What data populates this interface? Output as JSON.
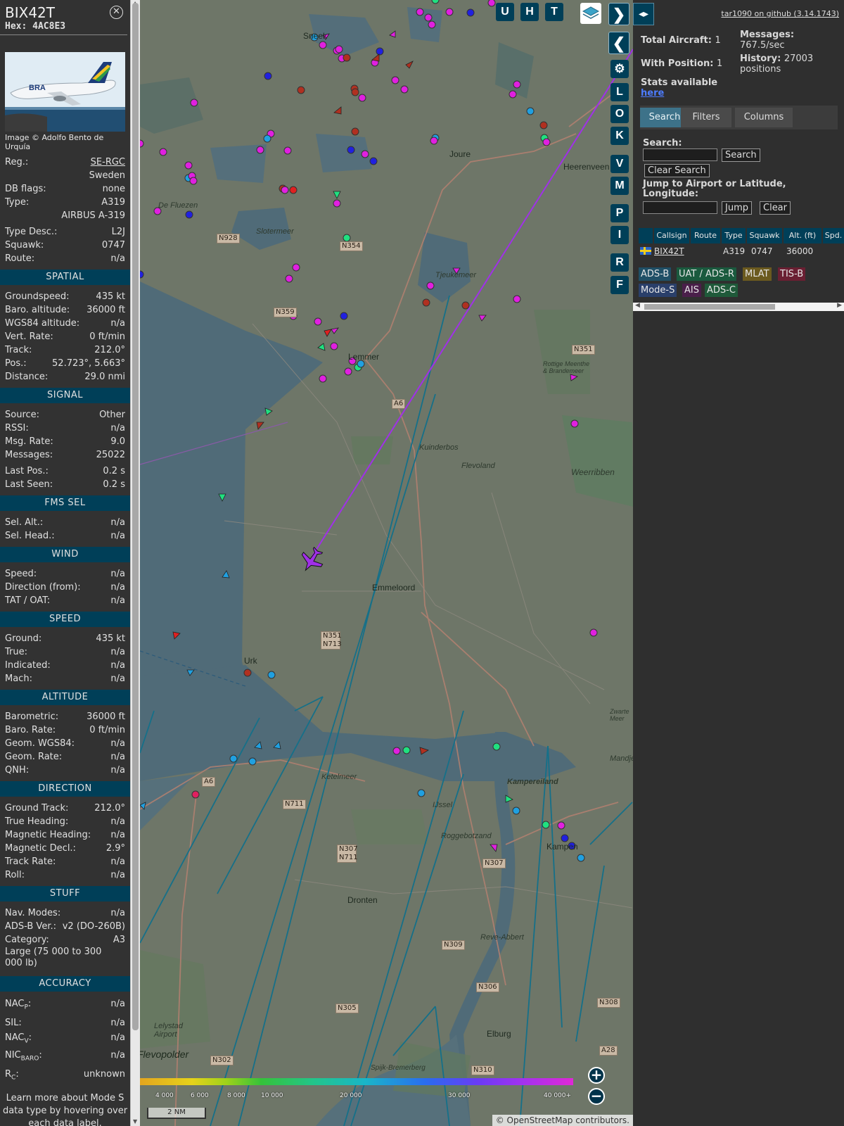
{
  "aircraft": {
    "callsign": "BIX42T",
    "hex_label": "Hex:",
    "hex": "4AC8E3",
    "image_credit": "Image © Adolfo Bento de Urquía",
    "reg_label": "Reg.:",
    "reg": "SE-RGC",
    "country": "Sweden",
    "dbflags_label": "DB flags:",
    "dbflags": "none",
    "type_label": "Type:",
    "type": "A319",
    "type_name": "AIRBUS A-319",
    "typedesc_label": "Type Desc.:",
    "typedesc": "L2J",
    "squawk_label": "Squawk:",
    "squawk": "0747",
    "route_label": "Route:",
    "route": "n/a"
  },
  "sections": {
    "spatial": "SPATIAL",
    "signal": "SIGNAL",
    "fms": "FMS SEL",
    "wind": "WIND",
    "speed": "SPEED",
    "altitude": "ALTITUDE",
    "direction": "DIRECTION",
    "stuff": "STUFF",
    "accuracy": "ACCURACY"
  },
  "spatial": [
    {
      "k": "Groundspeed:",
      "v": "435 kt"
    },
    {
      "k": "Baro. altitude:",
      "v": "36000 ft"
    },
    {
      "k": "WGS84 altitude:",
      "v": "n/a"
    },
    {
      "k": "Vert. Rate:",
      "v": "0 ft/min"
    },
    {
      "k": "Track:",
      "v": "212.0°"
    },
    {
      "k": "Pos.:",
      "v": "52.723°, 5.663°"
    },
    {
      "k": "Distance:",
      "v": "29.0 nmi"
    }
  ],
  "signal": [
    {
      "k": "Source:",
      "v": "Other"
    },
    {
      "k": "RSSI:",
      "v": "n/a"
    },
    {
      "k": "Msg. Rate:",
      "v": "9.0"
    },
    {
      "k": "Messages:",
      "v": "25022"
    },
    {
      "k": "Last Pos.:",
      "v": "0.2 s"
    },
    {
      "k": "Last Seen:",
      "v": "0.2 s"
    }
  ],
  "fms": [
    {
      "k": "Sel. Alt.:",
      "v": "n/a"
    },
    {
      "k": "Sel. Head.:",
      "v": "n/a"
    }
  ],
  "wind": [
    {
      "k": "Speed:",
      "v": "n/a"
    },
    {
      "k": "Direction (from):",
      "v": "n/a"
    },
    {
      "k": "TAT / OAT:",
      "v": "n/a"
    }
  ],
  "speed": [
    {
      "k": "Ground:",
      "v": "435 kt"
    },
    {
      "k": "True:",
      "v": "n/a"
    },
    {
      "k": "Indicated:",
      "v": "n/a"
    },
    {
      "k": "Mach:",
      "v": "n/a"
    }
  ],
  "altitude": [
    {
      "k": "Barometric:",
      "v": "36000 ft"
    },
    {
      "k": "Baro. Rate:",
      "v": "0 ft/min"
    },
    {
      "k": "Geom. WGS84:",
      "v": "n/a"
    },
    {
      "k": "Geom. Rate:",
      "v": "n/a"
    },
    {
      "k": "QNH:",
      "v": "n/a"
    }
  ],
  "direction": [
    {
      "k": "Ground Track:",
      "v": "212.0°"
    },
    {
      "k": "True Heading:",
      "v": "n/a"
    },
    {
      "k": "Magnetic Heading:",
      "v": "n/a"
    },
    {
      "k": "Magnetic Decl.:",
      "v": "2.9°"
    },
    {
      "k": "Track Rate:",
      "v": "n/a"
    },
    {
      "k": "Roll:",
      "v": "n/a"
    }
  ],
  "stuff": [
    {
      "k": "Nav. Modes:",
      "v": "n/a"
    },
    {
      "k": "ADS-B Ver.:",
      "v": "v2 (DO-260B)"
    },
    {
      "k": "Category:",
      "v": "A3"
    }
  ],
  "category_desc": "Large (75 000 to 300 000 lb)",
  "accuracy": {
    "nacp_label": "NAC",
    "nacp_sub": "P",
    "nacp": "n/a",
    "sil_label": "SIL:",
    "sil": "n/a",
    "nacv_label": "NAC",
    "nacv_sub": "V",
    "nacv": "n/a",
    "nicbaro_label": "NIC",
    "nicbaro_sub": "BARO",
    "nicbaro": "n/a",
    "rc_label": "R",
    "rc_sub": "C",
    "rc": "unknown"
  },
  "learn_more": "Learn more about Mode S data type by hovering over each data label.",
  "map": {
    "buttons_top": [
      "U",
      "H",
      "T"
    ],
    "buttons_side": [
      "L",
      "O",
      "K",
      "V",
      "M",
      "P",
      "I",
      "R",
      "F"
    ],
    "attribution": "© OpenStreetMap contributors.",
    "scale": "2 NM",
    "legend_labels": [
      "4 000",
      "6 000",
      "8 000",
      "10 000",
      "20 000",
      "30 000",
      "40 000+"
    ],
    "towns": [
      "Sneek",
      "Joure",
      "Heerenveen",
      "Lemmer",
      "Emmeloord",
      "Urk",
      "Dronten",
      "Kampen",
      "Elburg",
      "Flevopolder",
      "Kampereiland",
      "Weerribben",
      "Kuinderbos",
      "Flevoland",
      "Ketelmeer",
      "IJssel",
      "Slotermeer",
      "De Fluezen",
      "Tjeukemeer",
      "Roggebotzand",
      "Reve-Abbert",
      "Lelystad Airport",
      "Mandjes",
      "Rottige Meenthe & Brandemeer",
      "Spijk-Bremerberg",
      "Zwarte Meer"
    ],
    "roads": [
      "N928",
      "N354",
      "N359",
      "A6",
      "N351",
      "N351 N713",
      "N711",
      "N307 N711",
      "N307",
      "N309",
      "N306",
      "N305",
      "N302",
      "N310",
      "N308",
      "A28"
    ]
  },
  "right": {
    "github": "tar1090 on github (3.14.1743)",
    "total_label": "Total Aircraft:",
    "total": "1",
    "pos_label": "With Position:",
    "pos": "1",
    "stats_label": "Stats available",
    "stats_link": "here",
    "msgs_label": "Messages:",
    "msgs": "767.5/sec",
    "hist_label": "History:",
    "hist": "27003 positions",
    "tabs": [
      "Search",
      "Filters",
      "Columns"
    ],
    "search_label": "Search:",
    "search_btn": "Search",
    "clear_search_btn": "Clear Search",
    "jump_label": "Jump to Airport or Latitude, Longitude:",
    "jump_btn": "Jump",
    "clear_btn": "Clear",
    "table_headers": [
      "Callsign",
      "Route",
      "Type",
      "Squawk",
      "Alt. (ft)",
      "Spd."
    ],
    "table_row": {
      "callsign": "BIX42T",
      "route": "",
      "type": "A319",
      "squawk": "0747",
      "alt": "36000"
    },
    "sources": [
      "ADS-B",
      "UAT / ADS-R",
      "MLAT",
      "TIS-B",
      "Mode-S",
      "AIS",
      "ADS-C"
    ]
  },
  "colors": {
    "section_header": "#003f58",
    "aircraft_selected": "#a030e8",
    "adsb": "#1f4f66",
    "uat": "#1a5a3e",
    "mlat": "#6b5a1f",
    "tisb": "#6a1f32",
    "modes": "#2a3f6a",
    "ais": "#4a1f4a",
    "adsc": "#1f5a3a"
  }
}
